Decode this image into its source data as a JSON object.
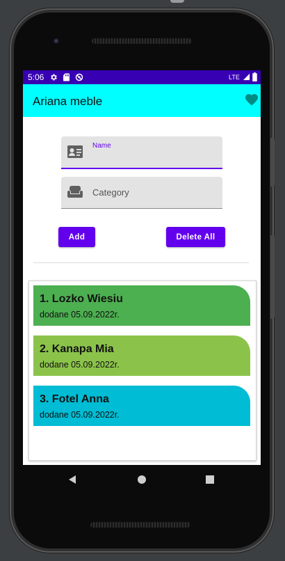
{
  "status_bar": {
    "time": "5:06",
    "network": "LTE",
    "icons": [
      "gear-icon",
      "sd-card-icon",
      "no-sync-icon",
      "signal-icon",
      "battery-icon"
    ]
  },
  "app_bar": {
    "title": "Ariana meble",
    "background": "#00ffff",
    "action_icon": "heart-icon",
    "action_color": "#008b84"
  },
  "form": {
    "name": {
      "label": "Name",
      "value": "",
      "icon": "contact-card-icon"
    },
    "category": {
      "placeholder": "Category",
      "value": "",
      "icon": "sofa-icon"
    },
    "add_label": "Add",
    "delete_all_label": "Delete All",
    "accent": "#6200ee"
  },
  "items": [
    {
      "title": "1. Lozko Wiesiu",
      "subtitle": "dodane 05.09.2022r.",
      "color": "#4caf50"
    },
    {
      "title": "2. Kanapa Mia",
      "subtitle": "dodane 05.09.2022r.",
      "color": "#8bc34a"
    },
    {
      "title": "3. Fotel Anna",
      "subtitle": "dodane 05.09.2022r.",
      "color": "#00bcd4"
    }
  ],
  "navigation": {
    "icons": [
      "back-icon",
      "home-icon",
      "recents-icon"
    ]
  }
}
